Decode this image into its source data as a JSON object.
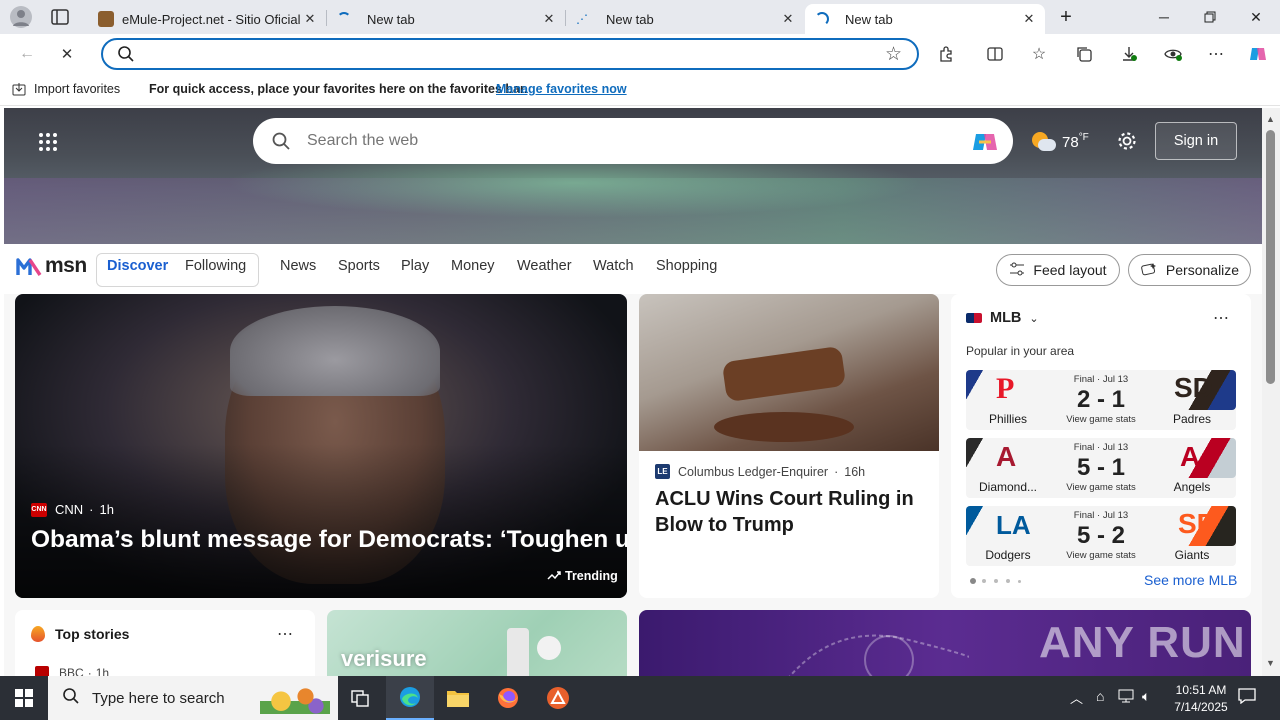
{
  "browser": {
    "tabs": [
      {
        "title": "eMule-Project.net - Sitio Oficial d"
      },
      {
        "title": "New tab"
      },
      {
        "title": "New tab"
      },
      {
        "title": "New tab"
      }
    ],
    "address": {
      "placeholder": "",
      "value": ""
    }
  },
  "favorites_bar": {
    "import_label": "Import favorites",
    "message": "For quick access, place your favorites here on the favorites bar.",
    "manage_link": "Manage favorites now"
  },
  "msn": {
    "search_placeholder": "Search the web",
    "weather_temp": "78",
    "weather_unit": "°F",
    "sign_in": "Sign in",
    "logo_text": "msn",
    "tabs": {
      "discover": "Discover",
      "following": "Following"
    },
    "nav": [
      "News",
      "Sports",
      "Play",
      "Money",
      "Weather",
      "Watch",
      "Shopping"
    ],
    "feed_layout": "Feed layout",
    "personalize": "Personalize"
  },
  "main_story": {
    "source": "CNN",
    "age": "1h",
    "headline": "Obama’s blunt message for Democrats: ‘Toughen up’",
    "trending": "Trending"
  },
  "second_story": {
    "source": "Columbus Ledger-Enquirer",
    "age": "16h",
    "headline": "ACLU Wins Court Ruling in Blow to Trump"
  },
  "mlb": {
    "title": "MLB",
    "subtitle": "Popular in your area",
    "see_more": "See more MLB",
    "games": [
      {
        "status": "Final · Jul 13",
        "score": "2 - 1",
        "stats": "View game stats",
        "home": "Phillies",
        "away": "Padres",
        "home_color": "#1e3a8a",
        "away_color": "#2f241d"
      },
      {
        "status": "Final · Jul 13",
        "score": "5 - 1",
        "stats": "View game stats",
        "home": "Diamond...",
        "away": "Angels",
        "home_color": "#a71930",
        "away_color": "#ba0021"
      },
      {
        "status": "Final · Jul 13",
        "score": "5 - 2",
        "stats": "View game stats",
        "home": "Dodgers",
        "away": "Giants",
        "home_color": "#005a9c",
        "away_color": "#fd5a1e"
      }
    ]
  },
  "top_stories": {
    "title": "Top stories",
    "source": "BBC",
    "age": "1h"
  },
  "ads": {
    "verisure": "verisure",
    "anyrun": "ANY RUN"
  },
  "taskbar": {
    "search_placeholder": "Type here to search",
    "time": "10:51 AM",
    "date": "7/14/2025"
  }
}
